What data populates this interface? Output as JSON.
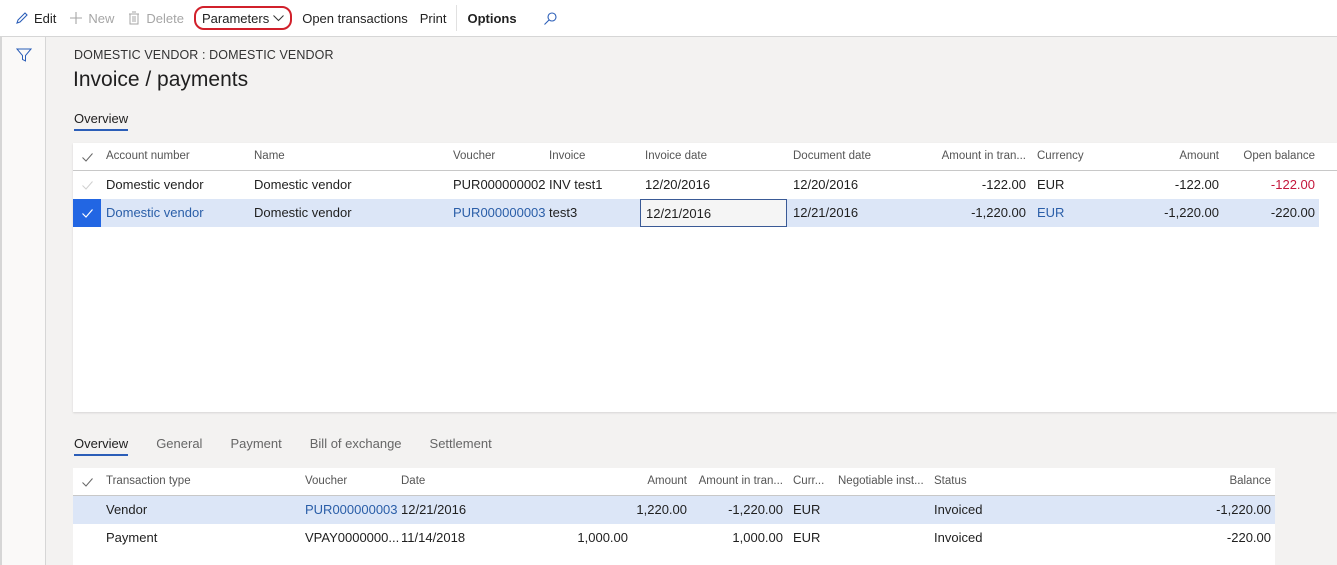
{
  "toolbar": {
    "edit": "Edit",
    "new": "New",
    "delete": "Delete",
    "parameters": "Parameters",
    "open_transactions": "Open transactions",
    "print": "Print",
    "options": "Options"
  },
  "page": {
    "caption": "DOMESTIC VENDOR : DOMESTIC VENDOR",
    "title": "Invoice / payments"
  },
  "top_tabs": [
    {
      "label": "Overview",
      "active": true
    }
  ],
  "invoices": {
    "headers": [
      "Account number",
      "Name",
      "Voucher",
      "Invoice",
      "Invoice date",
      "Document date",
      "Amount in tran...",
      "Currency",
      "Amount",
      "Open balance"
    ],
    "rows": [
      {
        "selected": false,
        "account": "Domestic vendor",
        "name": "Domestic vendor",
        "voucher": "PUR000000002",
        "invoice": "INV test1",
        "invoice_date": "12/20/2016",
        "document_date": "12/20/2016",
        "amount_tran": "-122.00",
        "currency": "EUR",
        "amount": "-122.00",
        "open_balance": "-122.00"
      },
      {
        "selected": true,
        "account": "Domestic vendor",
        "name": "Domestic vendor",
        "voucher": "PUR000000003",
        "invoice": "test3",
        "invoice_date": "12/21/2016",
        "document_date": "12/21/2016",
        "amount_tran": "-1,220.00",
        "currency": "EUR",
        "amount": "-1,220.00",
        "open_balance": "-220.00"
      }
    ]
  },
  "bottom_tabs": [
    {
      "label": "Overview",
      "active": true
    },
    {
      "label": "General",
      "active": false
    },
    {
      "label": "Payment",
      "active": false
    },
    {
      "label": "Bill of exchange",
      "active": false
    },
    {
      "label": "Settlement",
      "active": false
    }
  ],
  "transactions": {
    "headers": [
      "Transaction type",
      "Voucher",
      "Date",
      "Amount",
      "Amount in tran...",
      "Curr...",
      "Negotiable inst...",
      "Status",
      "Balance"
    ],
    "rows": [
      {
        "selected": true,
        "type": "Vendor",
        "voucher": "PUR000000003",
        "date": "12/21/2016",
        "debit": "",
        "amount": "1,220.00",
        "amount_tran": "-1,220.00",
        "currency": "EUR",
        "negotiable": "",
        "status": "Invoiced",
        "balance": "-1,220.00"
      },
      {
        "selected": false,
        "type": "Payment",
        "voucher": "VPAY0000000...",
        "date": "11/14/2018",
        "debit": "1,000.00",
        "amount": "",
        "amount_tran": "1,000.00",
        "currency": "EUR",
        "negotiable": "",
        "status": "Invoiced",
        "balance": "-220.00"
      }
    ]
  },
  "colors": {
    "accent": "#2266e3",
    "link": "#2a5ea8",
    "selected_row": "#dce6f7",
    "negative_red": "#c4163b",
    "highlight_outline": "#d1202b"
  }
}
